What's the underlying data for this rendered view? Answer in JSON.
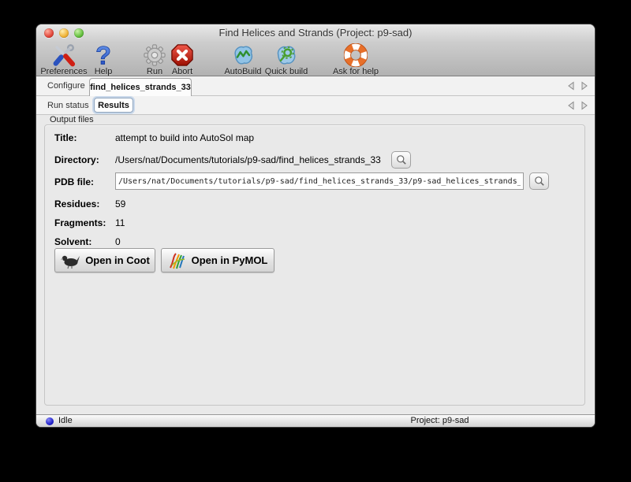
{
  "window": {
    "title": "Find Helices and Strands (Project: p9-sad)"
  },
  "toolbar": {
    "items": [
      {
        "label": "Preferences",
        "icon": "tools-icon"
      },
      {
        "label": "Help",
        "icon": "question-icon"
      },
      {
        "label": "Run",
        "icon": "gear-icon"
      },
      {
        "label": "Abort",
        "icon": "stop-icon"
      },
      {
        "label": "AutoBuild",
        "icon": "autobuild-icon"
      },
      {
        "label": "Quick build",
        "icon": "quickbuild-icon"
      },
      {
        "label": "Ask for help",
        "icon": "lifebuoy-icon"
      }
    ]
  },
  "tabs": {
    "row1": {
      "inactive": "Configure",
      "active": "find_helices_strands_33"
    },
    "row2": {
      "inactive": "Run status",
      "active": "Results"
    }
  },
  "output": {
    "group_label": "Output files",
    "title_label": "Title:",
    "title_value": "attempt to build into AutoSol map",
    "dir_label": "Directory:",
    "dir_value": "/Users/nat/Documents/tutorials/p9-sad/find_helices_strands_33",
    "pdb_label": "PDB file:",
    "pdb_value": "/Users/nat/Documents/tutorials/p9-sad/find_helices_strands_33/p9-sad_helices_strands_",
    "residues_label": "Residues:",
    "residues_value": "59",
    "fragments_label": "Fragments:",
    "fragments_value": "11",
    "solvent_label": "Solvent:",
    "solvent_value": "0",
    "coot_button": "Open in Coot",
    "pymol_button": "Open in PyMOL"
  },
  "statusbar": {
    "status": "Idle",
    "project": "Project: p9-sad"
  },
  "colors": {
    "abort_red": "#c41607",
    "help_blue": "#2b63d9",
    "lifebuoy_orange": "#e8702a",
    "status_blue": "#2a2ad0",
    "window_chrome_top": "#e8e8e8",
    "window_chrome_bottom": "#b2b2b2"
  }
}
